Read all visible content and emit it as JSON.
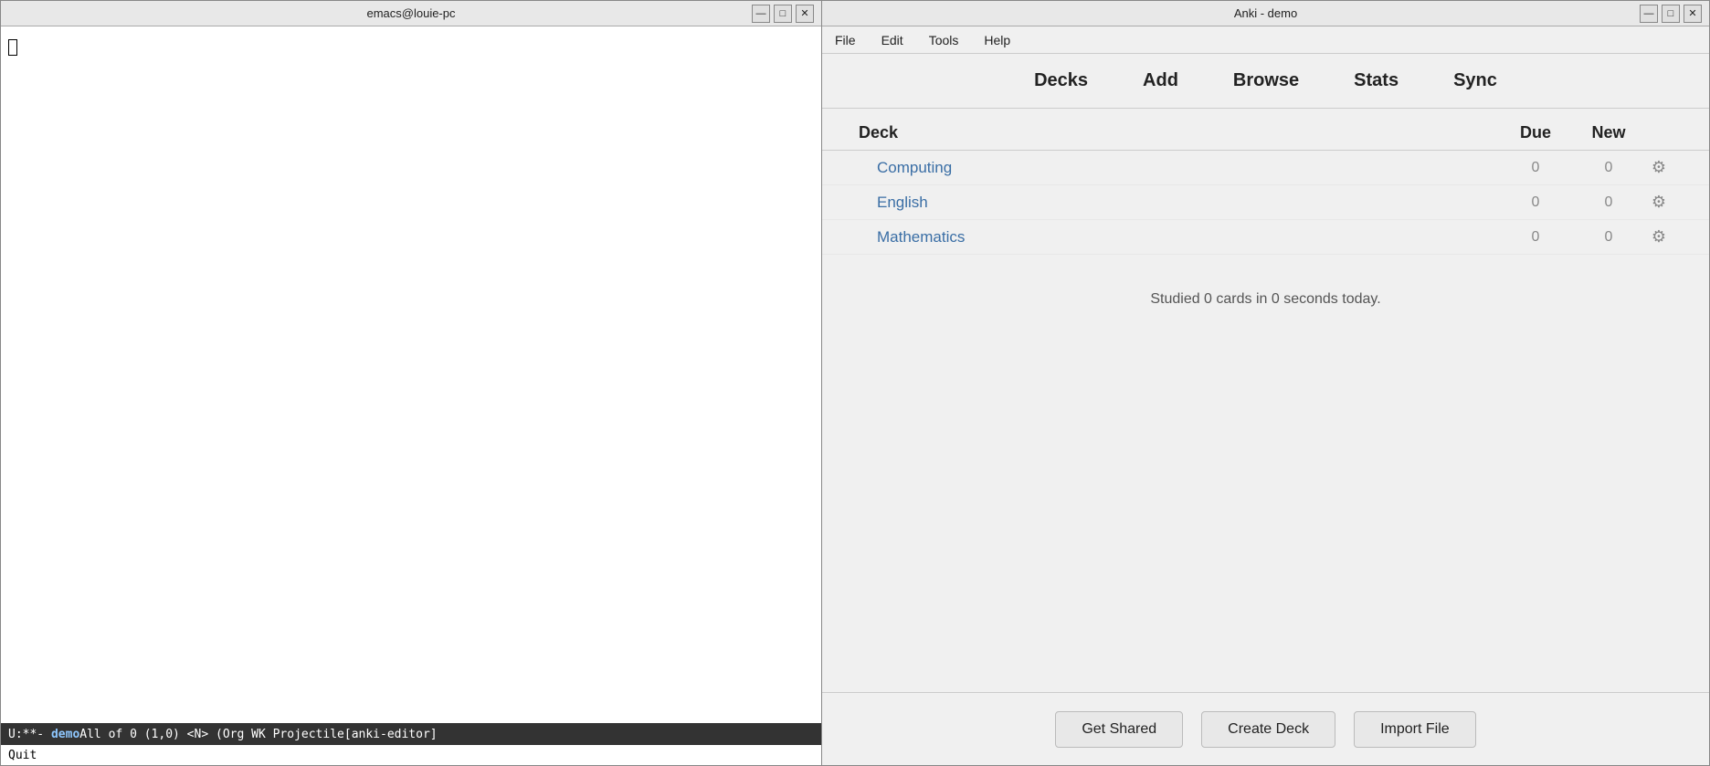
{
  "emacs": {
    "title": "emacs@louie-pc",
    "controls": {
      "minimize": "—",
      "maximize": "□",
      "close": "✕"
    },
    "modeline": {
      "status": "U:**-",
      "buffername": "demo",
      "rest": "    All of 0    (1,0)      <N>    (Org WK Projectile[anki-editor]"
    },
    "minibuffer": "Quit"
  },
  "anki": {
    "title": "Anki - demo",
    "controls": {
      "minimize": "—",
      "maximize": "□",
      "close": "✕"
    },
    "menubar": {
      "items": [
        "File",
        "Edit",
        "Tools",
        "Help"
      ]
    },
    "toolbar": {
      "items": [
        "Decks",
        "Add",
        "Browse",
        "Stats",
        "Sync"
      ]
    },
    "deck_list": {
      "header": {
        "deck_label": "Deck",
        "due_label": "Due",
        "new_label": "New"
      },
      "rows": [
        {
          "name": "Computing",
          "due": "0",
          "new": "0"
        },
        {
          "name": "English",
          "due": "0",
          "new": "0"
        },
        {
          "name": "Mathematics",
          "due": "0",
          "new": "0"
        }
      ]
    },
    "studied_text": "Studied 0 cards in 0 seconds today.",
    "footer": {
      "get_shared": "Get Shared",
      "create_deck": "Create Deck",
      "import_file": "Import File"
    }
  }
}
